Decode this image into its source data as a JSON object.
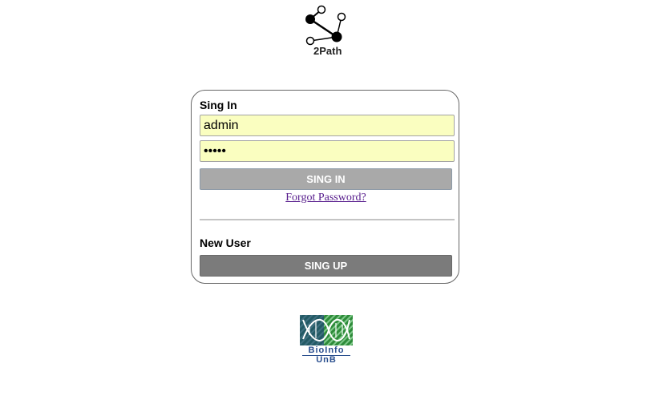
{
  "header_logo": {
    "text": "2Path",
    "icon": "molecule-graph-icon"
  },
  "signin": {
    "title": "Sing In",
    "username_value": "admin",
    "password_value": "admin",
    "button_label": "SING IN",
    "forgot_link": "Forgot Password?"
  },
  "signup": {
    "title": "New User",
    "button_label": "SING UP"
  },
  "footer_logo": {
    "line1": "BioInfo",
    "line2": "UnB",
    "icon": "dna-helix-icon"
  },
  "colors": {
    "field_bg": "#fafec0",
    "signin_button": "#a9a9a9",
    "signup_button": "#7b7b7b",
    "link": "#551a8b",
    "logo_blue": "#2a4f8f",
    "logo_green": "#2e8b3a"
  }
}
